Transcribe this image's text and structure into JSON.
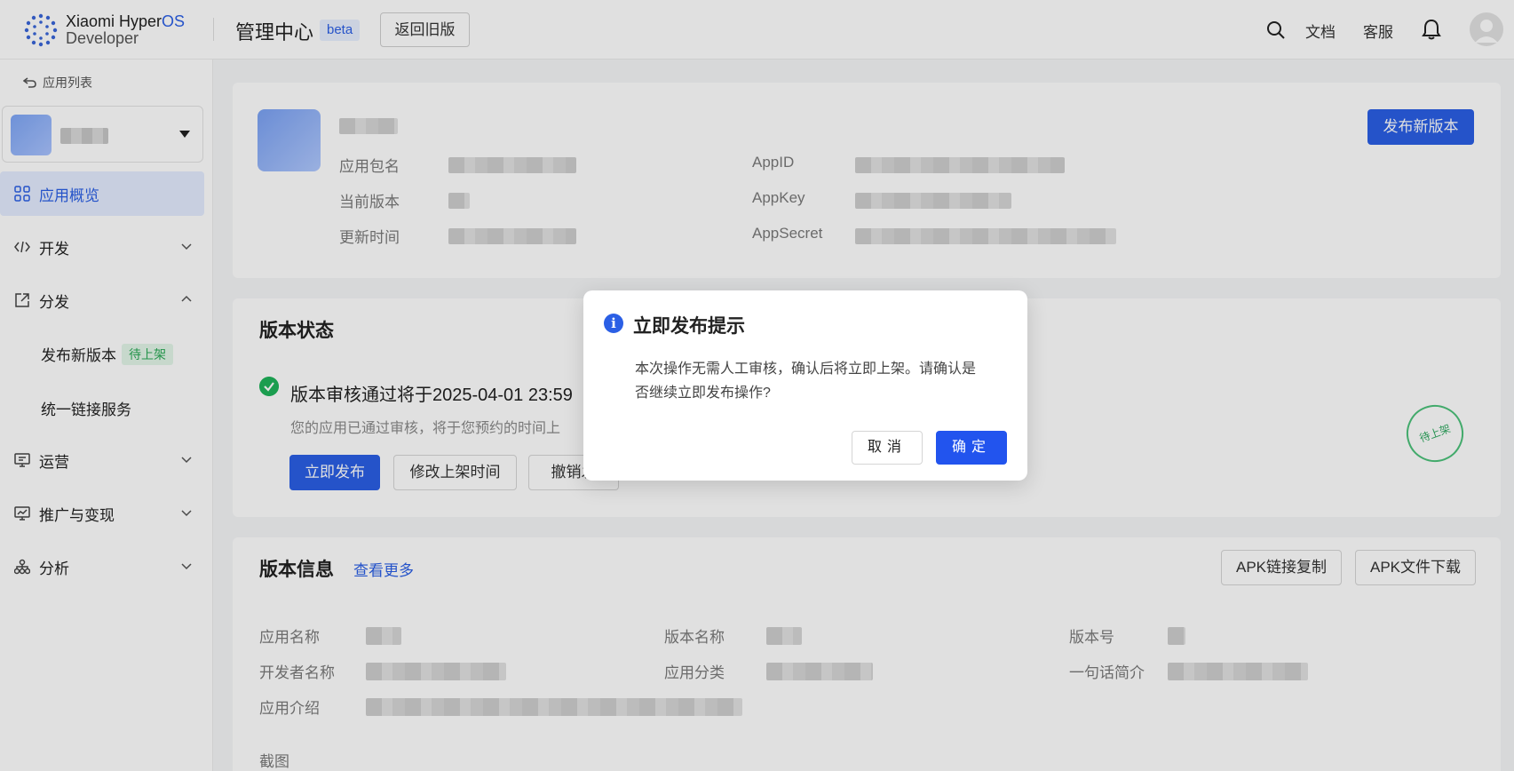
{
  "header": {
    "logo_line1": "Xiaomi Hyper",
    "logo_line1_os": "OS",
    "logo_line2": "Developer",
    "title": "管理中心",
    "beta": "beta",
    "back_old": "返回旧版",
    "docs": "文档",
    "support": "客服"
  },
  "sidebar": {
    "back_list": "应用列表",
    "items": [
      {
        "label": "应用概览",
        "icon": "grid-icon",
        "active": true
      },
      {
        "label": "开发",
        "icon": "code-icon"
      },
      {
        "label": "分发",
        "icon": "share-icon",
        "expanded": true
      },
      {
        "label": "运营",
        "icon": "monitor-icon"
      },
      {
        "label": "推广与变现",
        "icon": "chart-icon"
      },
      {
        "label": "分析",
        "icon": "hierarchy-icon"
      }
    ],
    "sub_items": [
      {
        "label": "发布新版本",
        "tag": "待上架"
      },
      {
        "label": "统一链接服务"
      }
    ]
  },
  "app_info": {
    "pkg_label": "应用包名",
    "version_label": "当前版本",
    "updated_label": "更新时间",
    "appid_label": "AppID",
    "appkey_label": "AppKey",
    "appsecret_label": "AppSecret",
    "publish_new": "发布新版本"
  },
  "version_status": {
    "title": "版本状态",
    "status_text": "版本审核通过将于2025-04-01 23:59",
    "status_sub": "您的应用已通过审核，将于您预约的时间上",
    "btn_publish_now": "立即发布",
    "btn_modify_time": "修改上架时间",
    "btn_revoke": "撤销发",
    "stamp": "待上架"
  },
  "version_info": {
    "title": "版本信息",
    "see_more": "查看更多",
    "btn_copy_apk": "APK链接复制",
    "btn_download_apk": "APK文件下载",
    "app_name_label": "应用名称",
    "version_name_label": "版本名称",
    "version_code_label": "版本号",
    "developer_label": "开发者名称",
    "category_label": "应用分类",
    "tagline_label": "一句话简介",
    "intro_label": "应用介绍",
    "screenshot_label": "截图"
  },
  "dialog": {
    "title": "立即发布提示",
    "body": "本次操作无需人工审核，确认后将立即上架。请确认是否继续立即发布操作?",
    "cancel": "取消",
    "ok": "确定"
  },
  "colors": {
    "accent": "#2b5fe5",
    "success": "#1fb35a"
  }
}
